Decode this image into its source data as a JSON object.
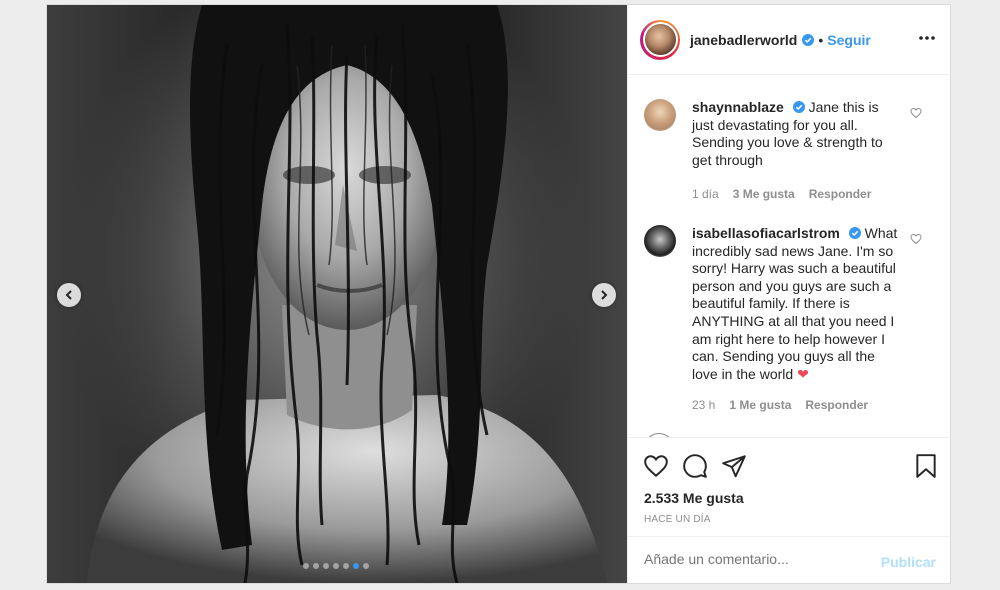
{
  "post": {
    "username": "janebadlerworld",
    "separator": "•",
    "follow_label": "Seguir",
    "likes_text": "2.533 Me gusta",
    "time_ago": "HACE UN DÍA"
  },
  "carousel": {
    "slide_count": 7,
    "active_index": 5
  },
  "comments": [
    {
      "user": "shaynnablaze",
      "text": "Jane this is just devastating for you all. Sending you love & strength to get through",
      "time": "1 día",
      "likes": "3 Me gusta",
      "reply": "Responder"
    },
    {
      "user": "isabellasofiacarlstrom",
      "text": "What incredibly sad news Jane. I'm so sorry! Harry was such a beautiful person and you guys are such a beautiful family. If there is ANYTHING at all that you need I am right here to help however I can. Sending you guys all the love in the world",
      "emoji": "❤",
      "time": "23 h",
      "likes": "1 Me gusta",
      "reply": "Responder"
    }
  ],
  "composer": {
    "placeholder": "Añade un comentario...",
    "publish_label": "Publicar"
  },
  "colors": {
    "accent": "#3897f0",
    "verified": "#3897f0",
    "muted": "#8e8e8e",
    "publish_disabled": "#b2dffc"
  },
  "icons": {
    "more": "more-options-icon",
    "like": "heart-icon",
    "comment": "comment-icon",
    "share": "share-icon",
    "save": "bookmark-icon",
    "prev": "chevron-left-icon",
    "next": "chevron-right-icon"
  }
}
